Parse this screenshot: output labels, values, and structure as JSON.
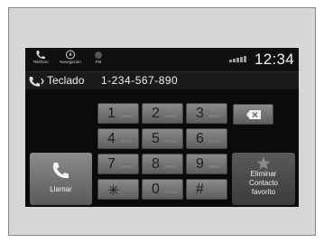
{
  "status_bar": {
    "phone_label": "Teléfono",
    "navigation_label": "Navegación",
    "fm_label": "FM",
    "clock": "12:34"
  },
  "dial": {
    "mode_label": "Teclado",
    "number": "1-234-567-890"
  },
  "keypad": {
    "keys": [
      "1",
      "2",
      "3",
      "4",
      "5",
      "6",
      "7",
      "8",
      "9",
      "✳",
      "0",
      "#"
    ]
  },
  "actions": {
    "call_label": "Llamar",
    "favorite_line1": "Eliminar",
    "favorite_line2": "Contacto",
    "favorite_line3": "favorito"
  },
  "colors": {
    "screen_background": "#0b0b0b",
    "key_face": "#7a7a7a",
    "text": "#f0f0f0"
  }
}
